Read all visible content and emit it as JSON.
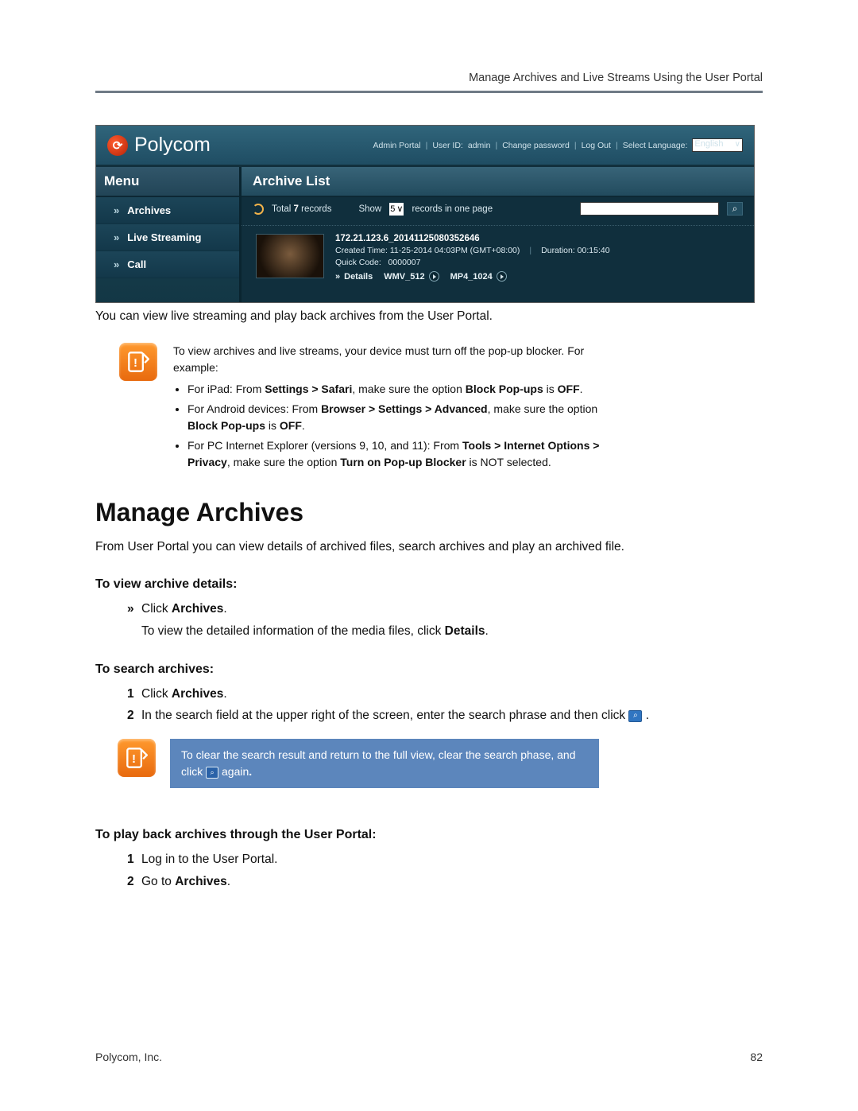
{
  "header": {
    "running_head": "Manage Archives and Live Streams Using the User Portal"
  },
  "screenshot": {
    "brand": "Polycom",
    "top_links": {
      "admin_portal": "Admin Portal",
      "user_id_label": "User ID:",
      "user_id_value": "admin",
      "change_pw": "Change password",
      "log_out": "Log Out",
      "lang_label": "Select Language:",
      "lang_value": "English"
    },
    "menu_title": "Menu",
    "menu": {
      "archives": "Archives",
      "live_streaming": "Live Streaming",
      "call": "Call"
    },
    "main": {
      "title": "Archive List",
      "total_prefix": "Total",
      "total_count": "7",
      "total_suffix": "records",
      "show_prefix": "Show",
      "show_value": "5",
      "show_suffix": "records in one page",
      "search_placeholder": ""
    },
    "item": {
      "filename": "172.21.123.6_20141125080352646",
      "created_label": "Created Time:",
      "created_value": "11-25-2014 04:03PM (GMT+08:00)",
      "duration_label": "Duration:",
      "duration_value": "00:15:40",
      "quickcode_label": "Quick Code:",
      "quickcode_value": "0000007",
      "details": "Details",
      "wmv": "WMV_512",
      "mp4": "MP4_1024"
    }
  },
  "body": {
    "intro": "You can view live streaming and play back archives from the User Portal.",
    "note1_intro": "To view archives and live streams, your device must turn off the pop-up blocker. For example:",
    "note1_li1_a": "For iPad: From ",
    "note1_li1_b": "Settings > Safari",
    "note1_li1_c": ", make sure the option ",
    "note1_li1_d": "Block Pop-ups",
    "note1_li1_e": " is ",
    "note1_li1_f": "OFF",
    "note1_li1_g": ".",
    "note1_li2_a": "For Android devices: From ",
    "note1_li2_b": "Browser > Settings > Advanced",
    "note1_li2_c": ", make sure the option ",
    "note1_li2_d": "Block Pop-ups",
    "note1_li2_e": " is ",
    "note1_li2_f": "OFF",
    "note1_li2_g": ".",
    "note1_li3_a": "For PC Internet Explorer (versions 9, 10, and 11): From ",
    "note1_li3_b": "Tools > Internet Options > Privacy",
    "note1_li3_c": ", make sure the option ",
    "note1_li3_d": "Turn on Pop-up Blocker",
    "note1_li3_e": " is NOT selected.",
    "h1": "Manage Archives",
    "desc": "From User Portal you can view details of archived files, search archives and play an archived file.",
    "h3_view": "To view archive details:",
    "view_s1_a": "Click ",
    "view_s1_b": "Archives",
    "view_s1_c": ".",
    "view_s2_a": "To view the detailed information of the media files, click ",
    "view_s2_b": "Details",
    "view_s2_c": ".",
    "h3_search": "To search archives:",
    "search_s1_a": "Click ",
    "search_s1_b": "Archives",
    "search_s1_c": ".",
    "search_s2": "In the search field at the upper right of the screen, enter the search phrase and then click ",
    "search_s2_end": ".",
    "callout_a": "To clear the search result and return to the full view, clear the search phase, and click ",
    "callout_b": " again",
    "callout_c": ".",
    "h3_play": "To play back archives through the User Portal:",
    "play_s1": "Log in to the User Portal.",
    "play_s2_a": "Go to ",
    "play_s2_b": "Archives",
    "play_s2_c": "."
  },
  "footer": {
    "company": "Polycom, Inc.",
    "page": "82"
  }
}
